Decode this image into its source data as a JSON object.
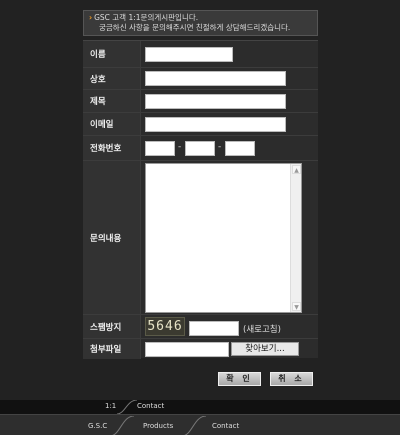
{
  "notice": {
    "line1": "GSC 고객 1:1문의게시판입니다.",
    "line2": "궁금하신 사항을 문의해주시면 친절하게 상담해드리겠습니다."
  },
  "form": {
    "name_label": "이름",
    "company_label": "상호",
    "subject_label": "제목",
    "email_label": "이메일",
    "phone_label": "전화번호",
    "phone_separator": "-",
    "content_label": "문의내용",
    "spam_label": "스팸방지",
    "captcha_code": "5646",
    "refresh_label": "(새로고침)",
    "attach_label": "첨부파일",
    "browse_label": "찾아보기..."
  },
  "buttons": {
    "confirm": "확 인",
    "cancel": "취 소"
  },
  "breadcrumb": {
    "section": "1:1",
    "page": "Contact"
  },
  "footer": {
    "home": "G.S.C",
    "products": "Products",
    "contact": "Contact"
  },
  "colors": {
    "accent": "#f29a1e",
    "background": "#222222"
  }
}
